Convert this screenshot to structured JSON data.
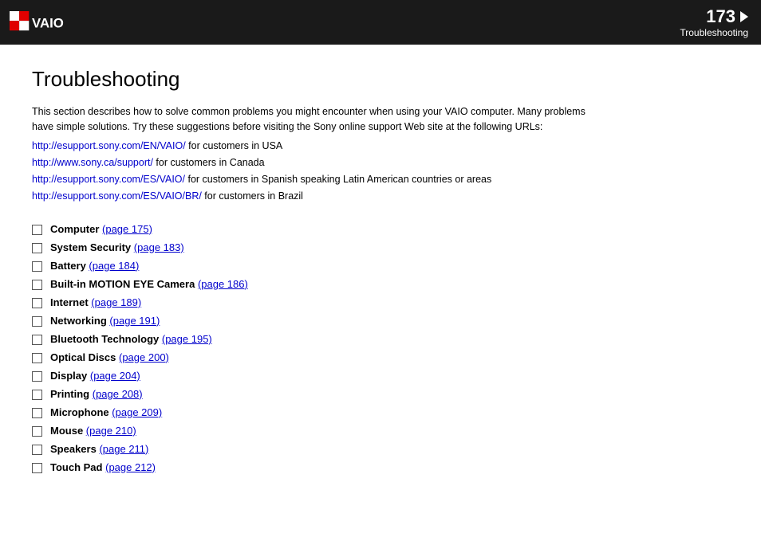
{
  "header": {
    "page_number": "173",
    "section": "Troubleshooting",
    "arrow_label": "▶"
  },
  "page_title": "Troubleshooting",
  "intro": {
    "line1": "This section describes how to solve common problems you might encounter when using your VAIO computer. Many problems",
    "line2": "have simple solutions. Try these suggestions before visiting the Sony online support Web site at the following URLs:"
  },
  "links": [
    {
      "url": "http://esupport.sony.com/EN/VAIO/",
      "suffix": " for customers in USA"
    },
    {
      "url": "http://www.sony.ca/support/",
      "suffix": " for customers in Canada"
    },
    {
      "url": "http://esupport.sony.com/ES/VAIO/",
      "suffix": " for customers in Spanish speaking Latin American countries or areas"
    },
    {
      "url": "http://esupport.sony.com/ES/VAIO/BR/",
      "suffix": " for customers in Brazil"
    }
  ],
  "items": [
    {
      "label": "Computer",
      "page_ref": "(page 175)"
    },
    {
      "label": "System Security",
      "page_ref": "(page 183)"
    },
    {
      "label": "Battery",
      "page_ref": "(page 184)"
    },
    {
      "label": "Built-in MOTION EYE Camera",
      "page_ref": "(page 186)"
    },
    {
      "label": "Internet",
      "page_ref": "(page 189)"
    },
    {
      "label": "Networking",
      "page_ref": "(page 191)"
    },
    {
      "label": "Bluetooth Technology",
      "page_ref": "(page 195)"
    },
    {
      "label": "Optical Discs",
      "page_ref": "(page 200)"
    },
    {
      "label": "Display",
      "page_ref": "(page 204)"
    },
    {
      "label": "Printing",
      "page_ref": "(page 208)"
    },
    {
      "label": "Microphone",
      "page_ref": "(page 209)"
    },
    {
      "label": "Mouse",
      "page_ref": "(page 210)"
    },
    {
      "label": "Speakers",
      "page_ref": "(page 211)"
    },
    {
      "label": "Touch Pad",
      "page_ref": "(page 212)"
    }
  ]
}
